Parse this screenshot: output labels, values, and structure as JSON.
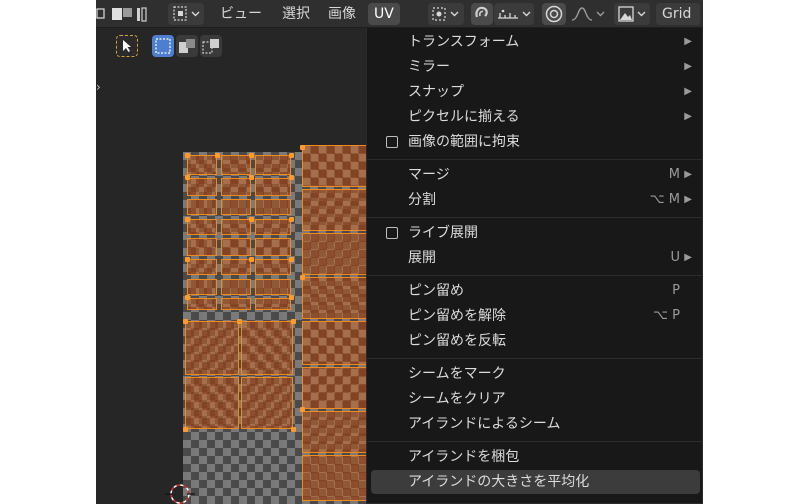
{
  "header": {
    "menus": [
      {
        "label": "ビュー",
        "active": false
      },
      {
        "label": "選択",
        "active": false
      },
      {
        "label": "画像",
        "active": false
      },
      {
        "label": "UV",
        "active": true
      }
    ],
    "grid_label": "Grid"
  },
  "uv_menu": {
    "items": [
      {
        "label": "トランスフォーム",
        "shortcut": "",
        "submenu": true,
        "checkbox": false
      },
      {
        "label": "ミラー",
        "shortcut": "",
        "submenu": true,
        "checkbox": false
      },
      {
        "label": "スナップ",
        "shortcut": "",
        "submenu": true,
        "checkbox": false
      },
      {
        "label": "ピクセルに揃える",
        "shortcut": "",
        "submenu": true,
        "checkbox": false
      },
      {
        "label": "画像の範囲に拘束",
        "shortcut": "",
        "submenu": false,
        "checkbox": true
      },
      {
        "label": "マージ",
        "shortcut": "M",
        "submenu": true,
        "checkbox": false
      },
      {
        "label": "分割",
        "shortcut": "⌥ M",
        "submenu": true,
        "checkbox": false
      },
      {
        "label": "ライブ展開",
        "shortcut": "",
        "submenu": false,
        "checkbox": true
      },
      {
        "label": "展開",
        "shortcut": "U",
        "submenu": true,
        "checkbox": false
      },
      {
        "label": "ピン留め",
        "shortcut": "P",
        "submenu": false,
        "checkbox": false
      },
      {
        "label": "ピン留めを解除",
        "shortcut": "⌥ P",
        "submenu": false,
        "checkbox": false
      },
      {
        "label": "ピン留めを反転",
        "shortcut": "",
        "submenu": false,
        "checkbox": false
      },
      {
        "label": "シームをマーク",
        "shortcut": "",
        "submenu": false,
        "checkbox": false
      },
      {
        "label": "シームをクリア",
        "shortcut": "",
        "submenu": false,
        "checkbox": false
      },
      {
        "label": "アイランドによるシーム",
        "shortcut": "",
        "submenu": false,
        "checkbox": false
      },
      {
        "label": "アイランドを梱包",
        "shortcut": "",
        "submenu": false,
        "checkbox": false
      },
      {
        "label": "アイランドの大きさを平均化",
        "shortcut": "",
        "submenu": false,
        "checkbox": false,
        "highlighted": true
      }
    ]
  },
  "colors": {
    "accent_orange": "#f08a1c",
    "menu_bg": "#181818",
    "header_bg": "#2f2f2f",
    "selection_blue": "#4d7ecf"
  },
  "icons": {
    "select_tool": "cursor-arrow-icon",
    "pivot": "pivot-point-icon",
    "snap": "magnet-icon",
    "proportional": "proportional-edit-icon",
    "image": "image-icon"
  }
}
